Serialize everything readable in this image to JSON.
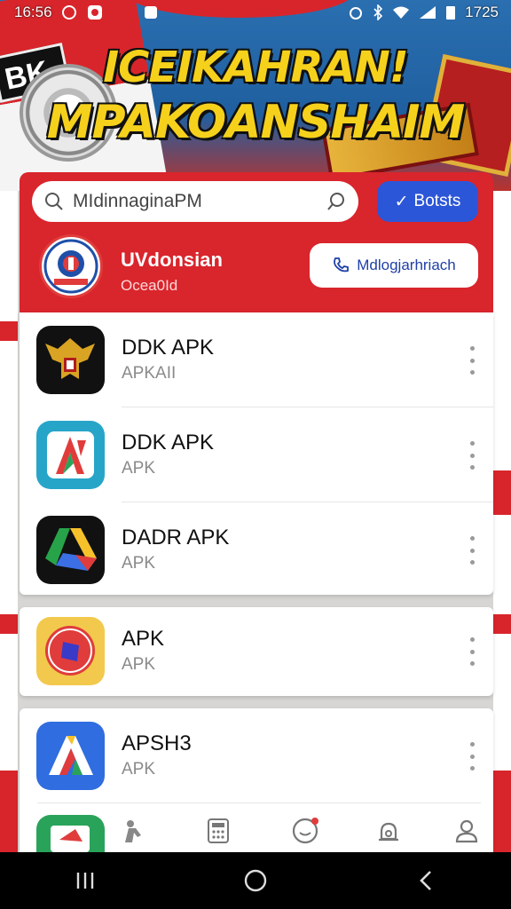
{
  "status": {
    "time": "16:56",
    "right_text": "1725",
    "left_icons": [
      "whatsapp-icon",
      "photo-icon",
      "app-icon"
    ],
    "right_icons": [
      "alarm-icon",
      "bluetooth-icon",
      "wifi-icon",
      "signal-icon",
      "battery-icon"
    ]
  },
  "banner": {
    "title_line1": "ICEIKAHRAN!",
    "title_line2": "MPAKOANSHAIM",
    "sign_text": "BK"
  },
  "search": {
    "value": "MIdinnaginaPM",
    "button_label": "Botsts",
    "button_check": "✓"
  },
  "brand": {
    "name": "UVdonsian",
    "subtitle": "Ocea0Id",
    "call_button": "Mdlogjarhriach"
  },
  "apps": [
    {
      "name": "DDK APK",
      "sub": "APKAII",
      "icon": "garuda-icon"
    },
    {
      "name": "DDK APK",
      "sub": "APK",
      "icon": "red-a-icon"
    },
    {
      "name": "DADR APK",
      "sub": "APK",
      "icon": "drive-triangle-icon"
    },
    {
      "name": "APK",
      "sub": "APK",
      "icon": "record-icon"
    },
    {
      "name": "APSH3",
      "sub": "APK",
      "icon": "colorful-a-icon"
    }
  ],
  "bottom_nav": [
    "fighter-icon",
    "calculator-icon",
    "chat-bubble-icon",
    "bell-icon",
    "profile-icon"
  ],
  "colors": {
    "accent_red": "#d9252c",
    "accent_blue": "#2c56d8",
    "banner_yellow": "#f6d11c"
  }
}
